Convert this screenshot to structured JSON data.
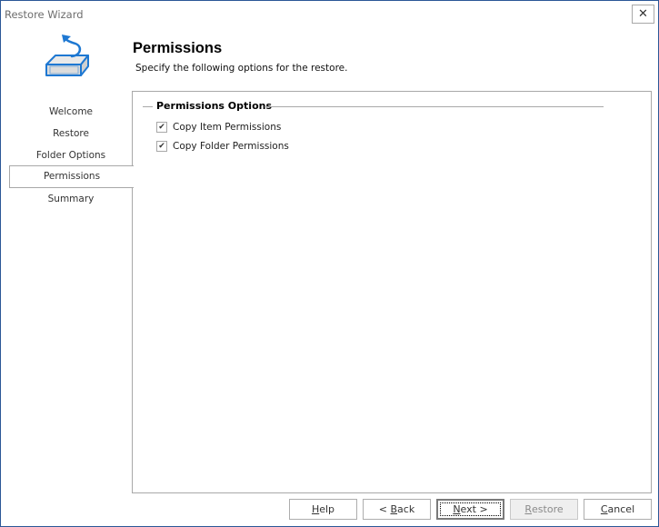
{
  "window": {
    "title": "Restore Wizard",
    "close_label": "✕"
  },
  "header": {
    "icon": "restore-box-icon",
    "title": "Permissions",
    "subtitle": "Specify the following options for the restore."
  },
  "sidebar": {
    "items": [
      {
        "label": "Welcome",
        "active": false
      },
      {
        "label": "Restore",
        "active": false
      },
      {
        "label": "Folder Options",
        "active": false
      },
      {
        "label": "Permissions",
        "active": true
      },
      {
        "label": "Summary",
        "active": false
      }
    ]
  },
  "content": {
    "group_title": "Permissions Options",
    "options": [
      {
        "label": "Copy Item Permissions",
        "checked": true
      },
      {
        "label": "Copy Folder Permissions",
        "checked": true
      }
    ],
    "check_glyph": "✔"
  },
  "footer": {
    "buttons": [
      {
        "key": "help",
        "mnemonic": "H",
        "rest": "elp",
        "prefix": "",
        "suffix": "",
        "enabled": true
      },
      {
        "key": "back",
        "mnemonic": "B",
        "rest": "ack",
        "prefix": "< ",
        "suffix": "",
        "enabled": true
      },
      {
        "key": "next",
        "mnemonic": "N",
        "rest": "ext >",
        "prefix": "",
        "suffix": "",
        "enabled": true,
        "default": true
      },
      {
        "key": "restore",
        "mnemonic": "R",
        "rest": "estore",
        "prefix": "",
        "suffix": "",
        "enabled": false
      },
      {
        "key": "cancel",
        "mnemonic": "C",
        "rest": "ancel",
        "prefix": "",
        "suffix": "",
        "enabled": true
      }
    ]
  },
  "colors": {
    "window_border": "#2b5797",
    "icon_blue": "#1e78d2",
    "border_gray": "#a8a8a8"
  }
}
